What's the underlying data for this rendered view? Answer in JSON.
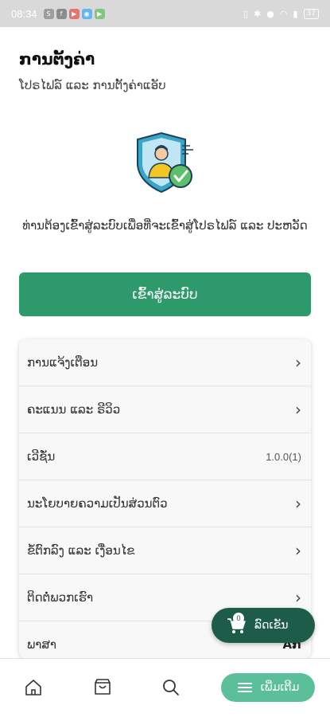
{
  "status_bar": {
    "time": "08:34",
    "apps": [
      {
        "icon": "s-app-icon",
        "glyph": "S",
        "color": "#9e9e9e"
      },
      {
        "icon": "facebook-icon",
        "glyph": "f",
        "color": "#8c8c8c"
      },
      {
        "icon": "youtube-icon",
        "glyph": "▶",
        "color": "#e57373"
      },
      {
        "icon": "app-icon",
        "glyph": "◉",
        "color": "#64b5f6"
      },
      {
        "icon": "play-icon",
        "glyph": "▶",
        "color": "#81c784"
      }
    ],
    "battery": "37"
  },
  "header": {
    "title": "ການຕັ້ງຄ່າ",
    "subtitle": "ໂປຣໄຟລ໌ ແລະ ການຕັ້ງຄ່າແອັບ"
  },
  "login": {
    "prompt": "ທ່ານຕ້ອງເຂົ້າສູ່ລະບົບເພື່ອທີ່ຈະເຂົ້າສູ່ໂປຣໄຟລ໌ ແລະ ປະຫວັດ",
    "button_label": "ເຂົ້າສູ່ລະບົບ"
  },
  "settings": {
    "items": [
      {
        "label": "ການແຈ້ງເຕືອນ",
        "trailing": "chevron"
      },
      {
        "label": "ຄະແນນ ແລະ ຣີວິວ",
        "trailing": "chevron"
      },
      {
        "label": "ເວີຊັ່ນ",
        "value": "1.0.0(1)"
      },
      {
        "label": "ນະໂຍບາຍຄວາມເປັນສ່ວນຕົວ",
        "trailing": "chevron"
      },
      {
        "label": "ຂໍ້ຕົກລົງ ແລະ ເງື່ອນໄຂ",
        "trailing": "chevron"
      },
      {
        "label": "ຕິດຕໍ່ພວກເຮົາ",
        "trailing": "chevron"
      },
      {
        "label": "ພາສາ",
        "value": "Aກ"
      }
    ],
    "chevron_glyph": "›"
  },
  "cart": {
    "count": "0",
    "label": "ລົດເຂັນ"
  },
  "bottom_nav": {
    "items": [
      "home-icon",
      "store-icon",
      "search-icon"
    ],
    "more_label": "ເພີ່ມເຕີມ"
  },
  "colors": {
    "primary": "#2e9a6b",
    "cart": "#1d5c49",
    "more": "#5bc09a"
  }
}
